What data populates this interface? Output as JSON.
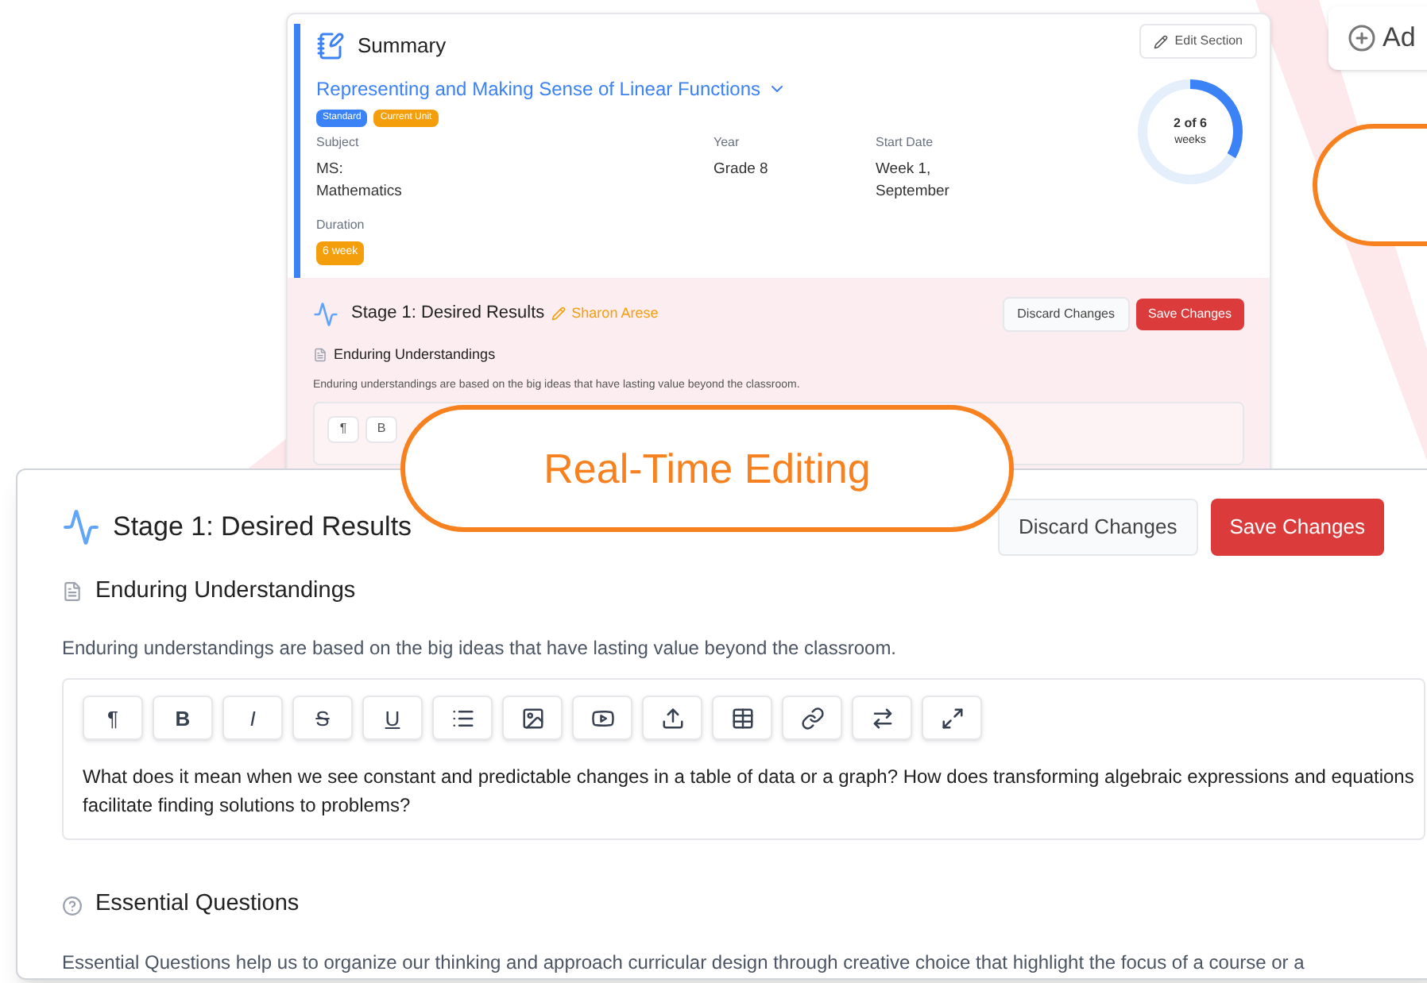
{
  "back_panel": {
    "summary": {
      "title": "Summary",
      "edit_button": "Edit Section",
      "unit_title": "Representing and Making Sense of Linear Functions",
      "tags": [
        {
          "label": "Standard",
          "color": "#3b82f6"
        },
        {
          "label": "Current Unit",
          "color": "#f59e0b"
        }
      ],
      "fields": [
        {
          "label": "Subject",
          "value": "MS: Mathematics"
        },
        {
          "label": "Year",
          "value": "Grade 8"
        },
        {
          "label": "Start Date",
          "value": "Week 1, September"
        }
      ],
      "duration_label": "Duration",
      "duration": "6 week",
      "progress": {
        "level": 0.3333,
        "reading": "2 of 6",
        "unit": "weeks"
      }
    },
    "stage": {
      "title": "Stage 1: Desired Results",
      "editor": "Sharon Arese",
      "discard": "Discard Changes",
      "save": "Save Changes",
      "section_title": "Enduring Understandings",
      "description": "Enduring understandings are based on the big ideas that have lasting value beyond the classroom.",
      "tools": [
        "¶",
        "B"
      ]
    }
  },
  "side_button": {
    "label": "Ad"
  },
  "front_panel": {
    "title": "Stage 1: Desired Results",
    "discard": "Discard Changes",
    "save": "Save Changes",
    "sections": [
      {
        "kind": "editor",
        "title": "Enduring Understandings",
        "description": "Enduring understandings are based on the big ideas that have lasting value beyond the classroom.",
        "text": "What does it mean when we see constant and predictable changes in a table of data or a graph? How does transforming algebraic expressions and equations facilitate finding solutions to problems?"
      },
      {
        "kind": "text",
        "title": "Essential Questions",
        "description": "Essential Questions help us to organize our thinking and approach curricular design through creative choice that highlight the focus of a course or a"
      }
    ],
    "tools": [
      {
        "kind": "paragraph",
        "label": "¶"
      },
      {
        "kind": "bold",
        "label": "B"
      },
      {
        "kind": "italic",
        "label": "I"
      },
      {
        "kind": "strike",
        "label": "S"
      },
      {
        "kind": "underline",
        "label": "U"
      },
      {
        "kind": "list"
      },
      {
        "kind": "image"
      },
      {
        "kind": "video"
      },
      {
        "kind": "upload"
      },
      {
        "kind": "table"
      },
      {
        "kind": "link"
      },
      {
        "kind": "swap"
      },
      {
        "kind": "expand"
      }
    ]
  },
  "callout": {
    "label": "Real-Time Editing"
  }
}
